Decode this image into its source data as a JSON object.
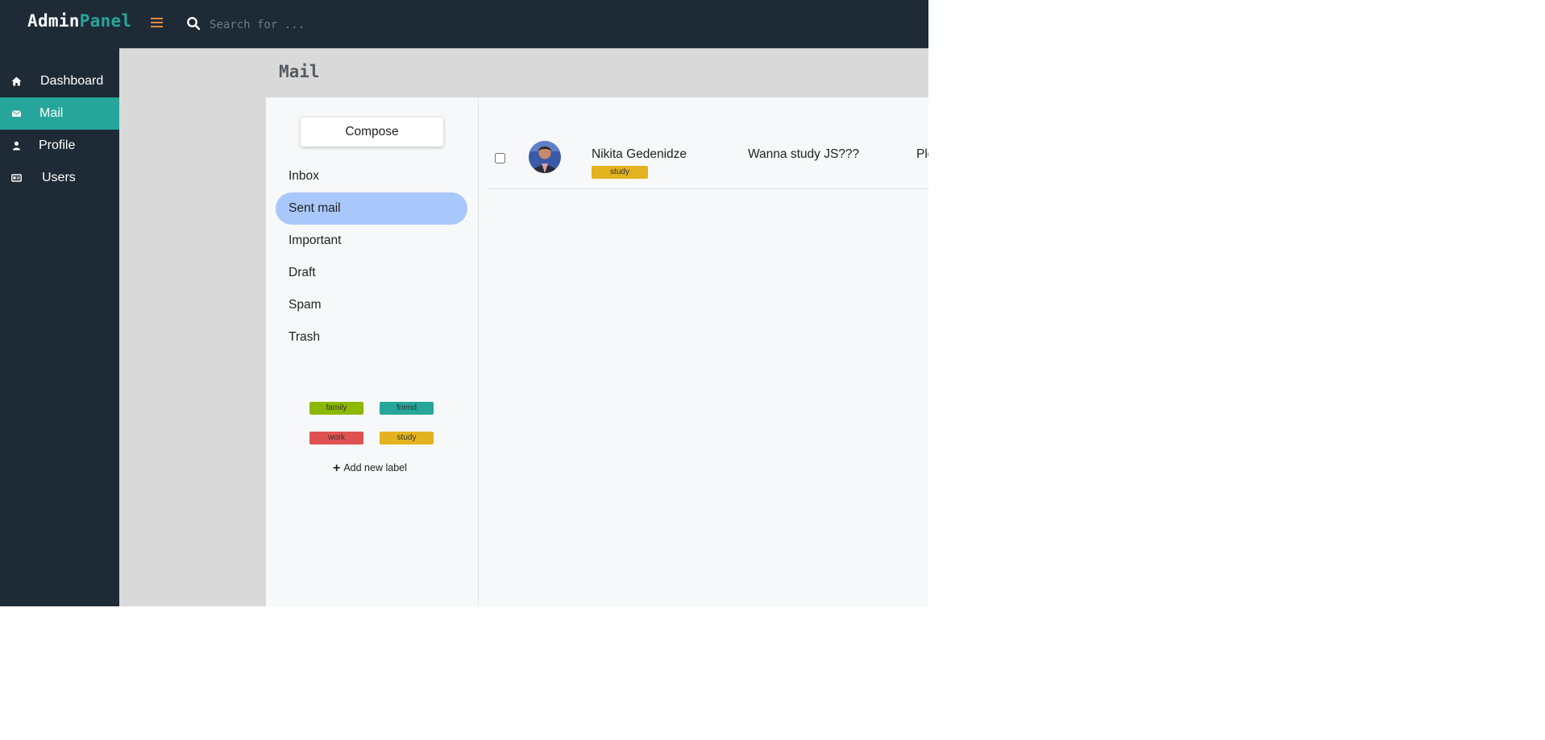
{
  "brand": {
    "part1": "Admin",
    "part2": "Panel"
  },
  "search": {
    "placeholder": "Search for ..."
  },
  "sidebar": {
    "items": [
      {
        "label": "Dashboard",
        "icon": "home-icon",
        "active": false
      },
      {
        "label": "Mail",
        "icon": "envelope-icon",
        "active": true
      },
      {
        "label": "Profile",
        "icon": "user-icon",
        "active": false
      },
      {
        "label": "Users",
        "icon": "id-card-icon",
        "active": false
      }
    ]
  },
  "page": {
    "title": "Mail"
  },
  "mail": {
    "compose_label": "Compose",
    "folders": [
      {
        "label": "Inbox",
        "active": false
      },
      {
        "label": "Sent mail",
        "active": true
      },
      {
        "label": "Important",
        "active": false
      },
      {
        "label": "Draft",
        "active": false
      },
      {
        "label": "Spam",
        "active": false
      },
      {
        "label": "Trash",
        "active": false
      }
    ],
    "labels": [
      {
        "name": "family",
        "color": "#8db800"
      },
      {
        "name": "friend",
        "color": "#26a69a"
      },
      {
        "name": "work",
        "color": "#e05252"
      },
      {
        "name": "study",
        "color": "#e2b31f"
      }
    ],
    "add_label_text": "Add new label",
    "messages": [
      {
        "sender": "Nikita Gedenidze",
        "tag": "study",
        "subject": "Wanna study JS???",
        "snippet": "Ple"
      }
    ]
  },
  "colors": {
    "sidebar_bg": "#1e2a36",
    "accent": "#26a69a",
    "hamburger": "#e08a3c",
    "active_folder": "#a8c7fa"
  }
}
